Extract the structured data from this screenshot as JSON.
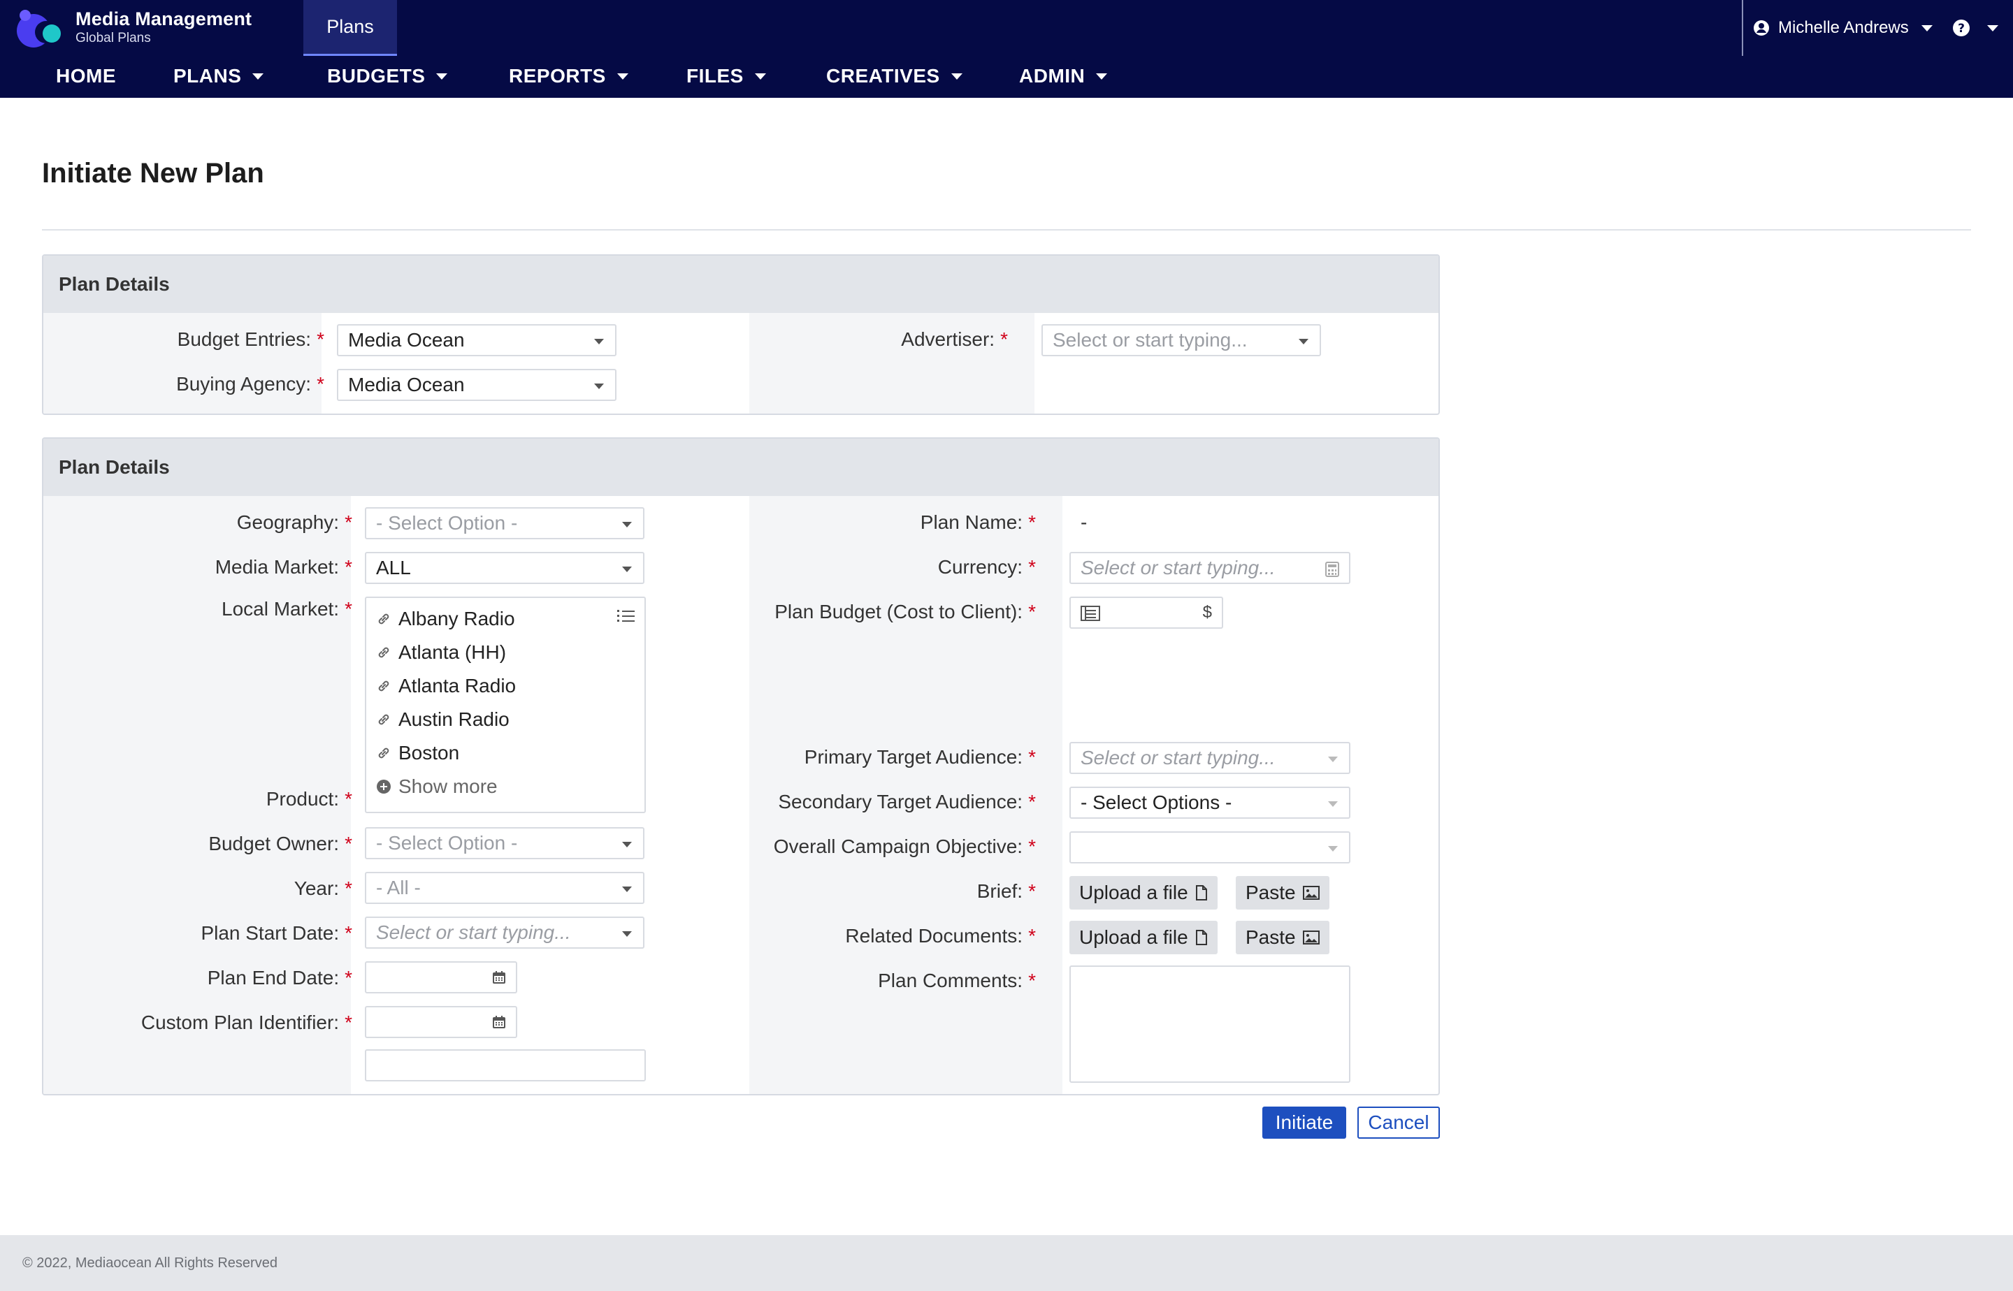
{
  "header": {
    "brand_title": "Media Management",
    "brand_subtitle": "Global Plans",
    "active_app_tab": "Plans",
    "user_name": "Michelle Andrews",
    "bg_color": "#050a45"
  },
  "nav": {
    "items": [
      {
        "label": "HOME"
      },
      {
        "label": "PLANS"
      },
      {
        "label": "BUDGETS"
      },
      {
        "label": "REPORTS"
      },
      {
        "label": "FILES"
      },
      {
        "label": "CREATIVES"
      },
      {
        "label": "ADMIN"
      }
    ]
  },
  "page": {
    "title": "Initiate New Plan"
  },
  "panel1": {
    "heading": "Plan Details",
    "budget_entries_label": "Budget Entries:",
    "budget_entries_value": "Media Ocean",
    "buying_agency_label": "Buying Agency:",
    "buying_agency_value": "Media Ocean",
    "advertiser_label": "Advertiser:",
    "advertiser_placeholder": "Select or start typing..."
  },
  "panel2": {
    "heading": "Plan Details",
    "left": {
      "geography_label": "Geography:",
      "geography_value": "- Select Option -",
      "media_market_label": "Media Market:",
      "media_market_value": "ALL",
      "local_market_label": "Local Market:",
      "local_market_items": [
        "Albany Radio",
        "Atlanta (HH)",
        "Atlanta Radio",
        "Austin Radio",
        "Boston"
      ],
      "show_more": "Show more",
      "product_label": "Product:",
      "budget_owner_label": "Budget Owner:",
      "budget_owner_value": "- Select Option -",
      "year_label": "Year:",
      "year_value": "- All -",
      "plan_start_label": "Plan Start Date:",
      "plan_start_placeholder": "Select or start typing...",
      "plan_end_label": "Plan End Date:",
      "custom_id_label": "Custom Plan Identifier:"
    },
    "right": {
      "plan_name_label": "Plan Name:",
      "plan_name_value": "-",
      "currency_label": "Currency:",
      "currency_placeholder": "Select or start typing...",
      "plan_budget_label": "Plan Budget (Cost to Client):",
      "plan_budget_currency": "$",
      "primary_audience_label": "Primary Target Audience:",
      "primary_audience_placeholder": "Select or start typing...",
      "secondary_audience_label": "Secondary Target Audience:",
      "secondary_audience_value": "- Select Options -",
      "objective_label": "Overall Campaign Objective:",
      "brief_label": "Brief:",
      "related_docs_label": "Related Documents:",
      "upload_label": "Upload a file",
      "paste_label": "Paste",
      "comments_label": "Plan Comments:"
    }
  },
  "actions": {
    "initiate": "Initiate",
    "cancel": "Cancel"
  },
  "footer": {
    "copyright": "© 2022, Mediaocean All Rights Reserved"
  },
  "icons": {
    "required": "*"
  }
}
